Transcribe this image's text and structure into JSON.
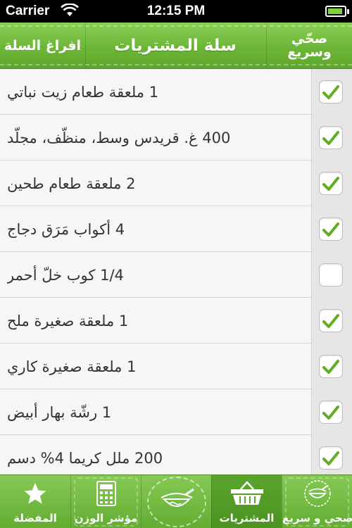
{
  "status_bar": {
    "carrier": "Carrier",
    "time": "12:15 PM",
    "battery_level": 0.9
  },
  "nav": {
    "left_button": "افراغ السلة",
    "title": "سلة المشتريات",
    "logo_line1": "صحّي",
    "logo_line2": "وسريع"
  },
  "items": [
    {
      "text": "1 ملعقة طعام زيت نباتي",
      "checked": true
    },
    {
      "text": "400 غ. قريدس وسط، منظّف، مجلّد",
      "checked": true
    },
    {
      "text": "2 ملعقة طعام طحين",
      "checked": true
    },
    {
      "text": "4 أكواب مَرَق دجاج",
      "checked": true
    },
    {
      "text": "1/4 كوب خلّ أحمر",
      "checked": false
    },
    {
      "text": "1 ملعقة صغيرة ملح",
      "checked": true
    },
    {
      "text": "1 ملعقة صغيرة كاري",
      "checked": true
    },
    {
      "text": "1 رشّة بهار أبيض",
      "checked": true
    },
    {
      "text": "200 ملل كريما 4% دسم",
      "checked": true
    }
  ],
  "tabs": [
    {
      "label": "المفضلة",
      "icon": "star-icon"
    },
    {
      "label": "مؤشر الوزن",
      "icon": "calculator-icon"
    },
    {
      "label": "",
      "icon": "logo-bowl-icon"
    },
    {
      "label": "المشتريات",
      "icon": "basket-icon",
      "active": true
    },
    {
      "label": "صحي و سريع",
      "icon": "bowl-logo-icon"
    }
  ],
  "colors": {
    "brand_green": "#6cb637",
    "check_green": "#5eae1f"
  }
}
